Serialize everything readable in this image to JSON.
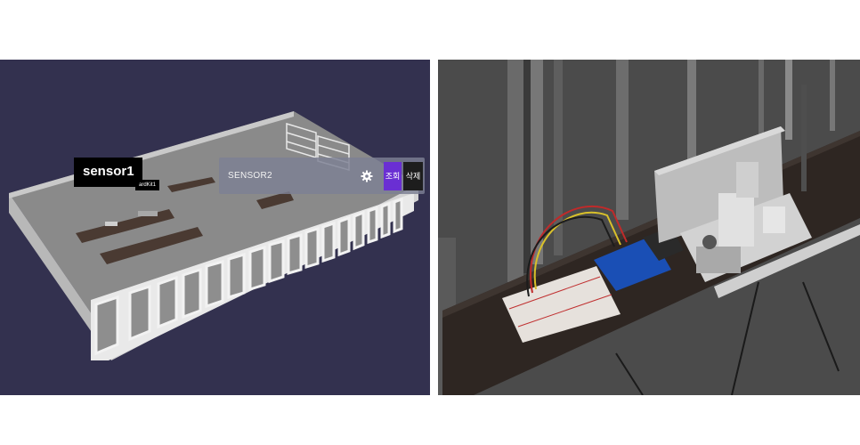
{
  "left_view": {
    "sensor_label": "sensor1",
    "kit_label": "ardKit1",
    "panel": {
      "name": "SENSOR2",
      "view_button": "조회",
      "delete_button": "삭제",
      "settings_icon": "gear-icon"
    }
  },
  "colors": {
    "left_background": "#33314f",
    "right_background": "#4a4a4a",
    "view_button": "#6a2fd3",
    "delete_button": "#1d1d1d"
  }
}
